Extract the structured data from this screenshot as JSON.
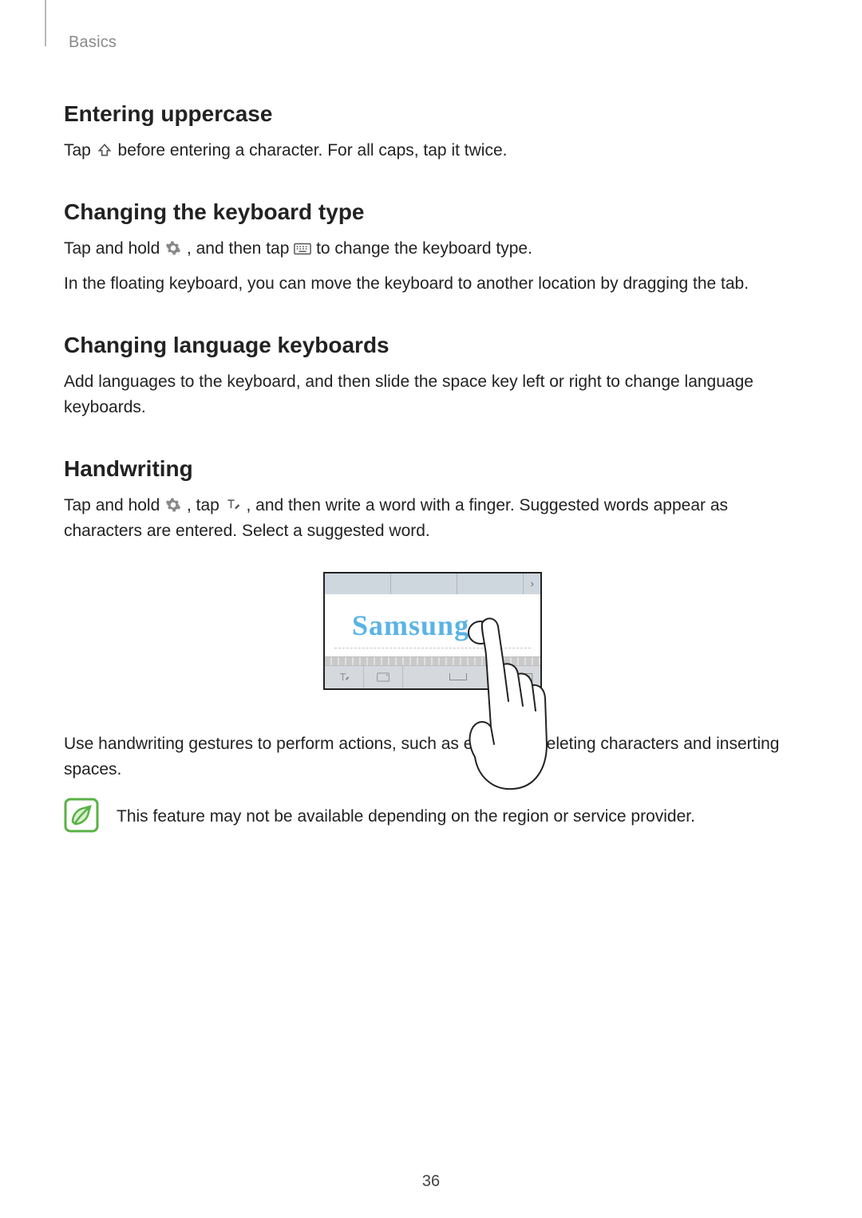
{
  "breadcrumb": "Basics",
  "page_number": "36",
  "sections": {
    "uppercase": {
      "title": "Entering uppercase",
      "p1a": "Tap ",
      "p1b": " before entering a character. For all caps, tap it twice."
    },
    "kbtype": {
      "title": "Changing the keyboard type",
      "p1a": "Tap and hold ",
      "p1b": ", and then tap ",
      "p1c": " to change the keyboard type.",
      "p2": "In the floating keyboard, you can move the keyboard to another location by dragging the tab."
    },
    "lang": {
      "title": "Changing language keyboards",
      "p1": "Add languages to the keyboard, and then slide the space key left or right to change language keyboards."
    },
    "handwriting": {
      "title": "Handwriting",
      "p1a": "Tap and hold ",
      "p1b": ", tap ",
      "p1c": ", and then write a word with a finger. Suggested words appear as characters are entered. Select a suggested word.",
      "sample_word": "Samsung",
      "p2": "Use handwriting gestures to perform actions, such as editing or deleting characters and inserting spaces."
    }
  },
  "note": {
    "text": "This feature may not be available depending on the region or service provider."
  },
  "icons": {
    "shift": "shift-icon",
    "gear": "gear-icon",
    "keyboard": "keyboard-icon",
    "handwriting_t": "t-pen-icon",
    "note": "note-icon"
  }
}
